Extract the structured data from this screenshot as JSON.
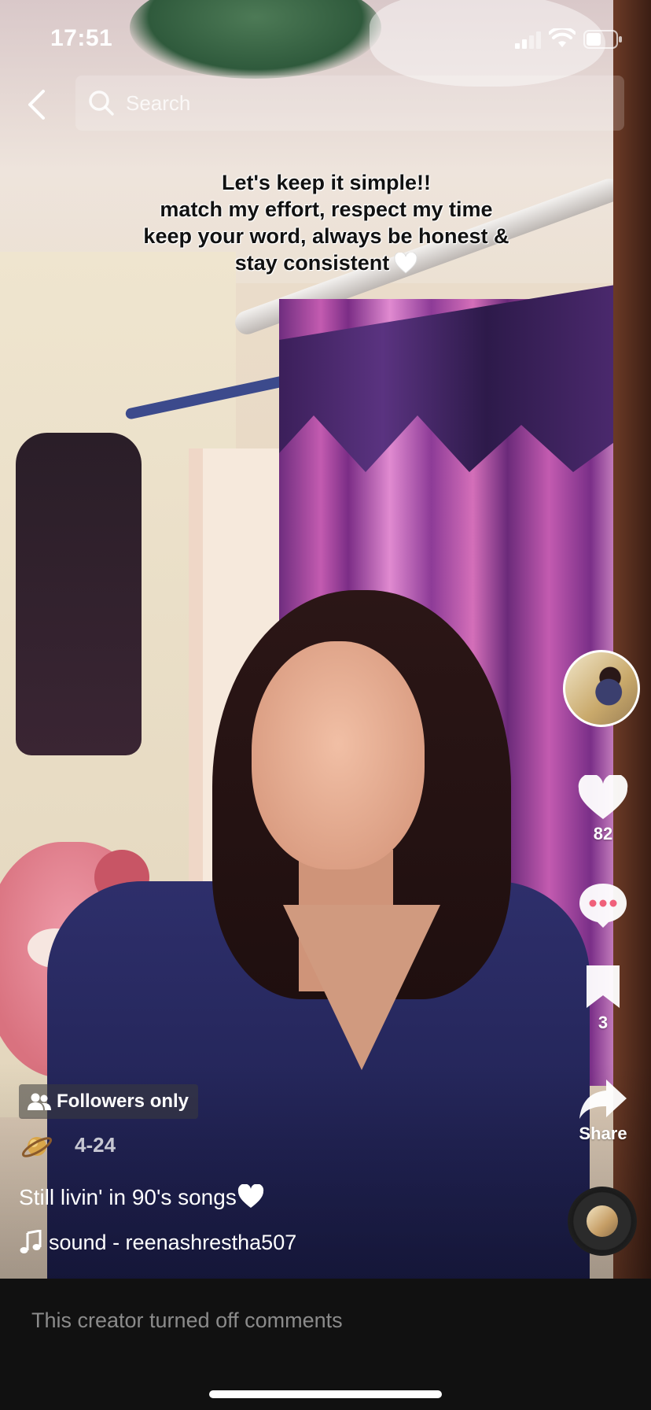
{
  "status_bar": {
    "time": "17:51"
  },
  "search": {
    "placeholder": "Search"
  },
  "overlay": {
    "lines": [
      "Let's keep it simple!!",
      "match my effort, respect my time",
      "keep your word, always be honest &",
      "stay consistent"
    ]
  },
  "actions": {
    "like_count": "82",
    "save_count": "3",
    "share_label": "Share"
  },
  "post": {
    "visibility_badge": "Followers only",
    "date": "4-24",
    "caption": "Still livin' in 90's songs",
    "sound": "sound - reenashrestha507"
  },
  "footer": {
    "comments_off_text": "This creator turned off comments"
  },
  "colors": {
    "background": "#111111",
    "muted_text": "#8b8b8b",
    "overlay_text": "#111111"
  },
  "icons": [
    "back-icon",
    "search-icon",
    "heart-icon",
    "comment-icon",
    "bookmark-icon",
    "share-icon",
    "music-note-icon",
    "users-icon",
    "planet-emoji-icon"
  ]
}
